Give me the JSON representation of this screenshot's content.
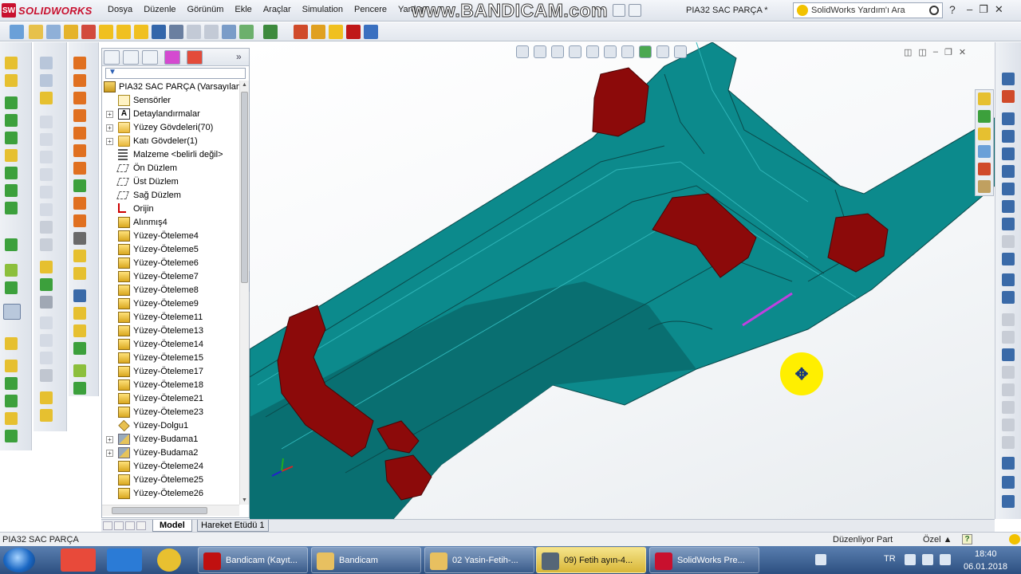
{
  "app": {
    "logo_text": "SOLIDWORKS",
    "logo_badge": "SW",
    "menu": [
      "Dosya",
      "Düzenle",
      "Görünüm",
      "Ekle",
      "Araçlar",
      "Simulation",
      "Pencere",
      "Yardım"
    ],
    "watermark": "www.BANDICAM.com",
    "document_title": "PIA32 SAC PARÇA *",
    "help_search_placeholder": "SolidWorks Yardım'ı Ara",
    "help_label": "?"
  },
  "feature_manager": {
    "filter_label": "▼",
    "root": "PIA32 SAC PARÇA  (Varsayılan<",
    "items": [
      {
        "label": "Sensörler",
        "icon": "sensor-icon",
        "expandable": false
      },
      {
        "label": "Detaylandırmalar",
        "icon": "annotation-icon",
        "expandable": true
      },
      {
        "label": "Yüzey Gövdeleri(70)",
        "icon": "surface-bodies-icon",
        "expandable": true
      },
      {
        "label": "Katı Gövdeler(1)",
        "icon": "solid-bodies-icon",
        "expandable": true
      },
      {
        "label": "Malzeme <belirli değil>",
        "icon": "material-icon",
        "expandable": false
      },
      {
        "label": "Ön Düzlem",
        "icon": "plane-icon",
        "expandable": false
      },
      {
        "label": "Üst Düzlem",
        "icon": "plane-icon",
        "expandable": false
      },
      {
        "label": "Sağ Düzlem",
        "icon": "plane-icon",
        "expandable": false
      },
      {
        "label": "Orijin",
        "icon": "origin-icon",
        "expandable": false
      },
      {
        "label": "Alınmış4",
        "icon": "imported-icon",
        "expandable": false
      },
      {
        "label": "Yüzey-Öteleme4",
        "icon": "offset-surface-icon",
        "expandable": false
      },
      {
        "label": "Yüzey-Öteleme5",
        "icon": "offset-surface-icon",
        "expandable": false
      },
      {
        "label": "Yüzey-Öteleme6",
        "icon": "offset-surface-icon",
        "expandable": false
      },
      {
        "label": "Yüzey-Öteleme7",
        "icon": "offset-surface-icon",
        "expandable": false
      },
      {
        "label": "Yüzey-Öteleme8",
        "icon": "offset-surface-icon",
        "expandable": false
      },
      {
        "label": "Yüzey-Öteleme9",
        "icon": "offset-surface-icon",
        "expandable": false
      },
      {
        "label": "Yüzey-Öteleme11",
        "icon": "offset-surface-icon",
        "expandable": false
      },
      {
        "label": "Yüzey-Öteleme13",
        "icon": "offset-surface-icon",
        "expandable": false
      },
      {
        "label": "Yüzey-Öteleme14",
        "icon": "offset-surface-icon",
        "expandable": false
      },
      {
        "label": "Yüzey-Öteleme15",
        "icon": "offset-surface-icon",
        "expandable": false
      },
      {
        "label": "Yüzey-Öteleme17",
        "icon": "offset-surface-icon",
        "expandable": false
      },
      {
        "label": "Yüzey-Öteleme18",
        "icon": "offset-surface-icon",
        "expandable": false
      },
      {
        "label": "Yüzey-Öteleme21",
        "icon": "offset-surface-icon",
        "expandable": false
      },
      {
        "label": "Yüzey-Öteleme23",
        "icon": "offset-surface-icon",
        "expandable": false
      },
      {
        "label": "Yüzey-Dolgu1",
        "icon": "fill-surface-icon",
        "expandable": false
      },
      {
        "label": "Yüzey-Budama1",
        "icon": "trim-surface-icon",
        "expandable": true
      },
      {
        "label": "Yüzey-Budama2",
        "icon": "trim-surface-icon",
        "expandable": true
      },
      {
        "label": "Yüzey-Öteleme24",
        "icon": "offset-surface-icon",
        "expandable": false
      },
      {
        "label": "Yüzey-Öteleme25",
        "icon": "offset-surface-icon",
        "expandable": false
      },
      {
        "label": "Yüzey-Öteleme26",
        "icon": "offset-surface-icon",
        "expandable": false
      }
    ]
  },
  "bottom_tabs": {
    "model": "Model",
    "motion": "Hareket Etüdü 1"
  },
  "status": {
    "left": "PIA32 SAC PARÇA",
    "editing": "Düzenliyor Part",
    "custom": "Özel ▲",
    "help": "?"
  },
  "taskbar": {
    "tasks": [
      {
        "label": "Bandicam (Kayıt...",
        "icon": "bandicam-record-icon",
        "active": false
      },
      {
        "label": "Bandicam",
        "icon": "folder-icon",
        "active": false
      },
      {
        "label": "02 Yasin-Fetih-...",
        "icon": "folder-icon",
        "active": false
      },
      {
        "label": "09) Fetih ayın-4...",
        "icon": "video-icon",
        "active": true
      },
      {
        "label": "SolidWorks Pre...",
        "icon": "solidworks-icon",
        "active": false
      }
    ],
    "language": "TR",
    "time": "18:40",
    "date": "06.01.2018"
  },
  "colors": {
    "model_surface": "#0a7f82",
    "model_edge": "#0b3d3e",
    "model_feature": "#8c0a0a",
    "highlight": "#ffef00",
    "accent": "#c8102e"
  }
}
